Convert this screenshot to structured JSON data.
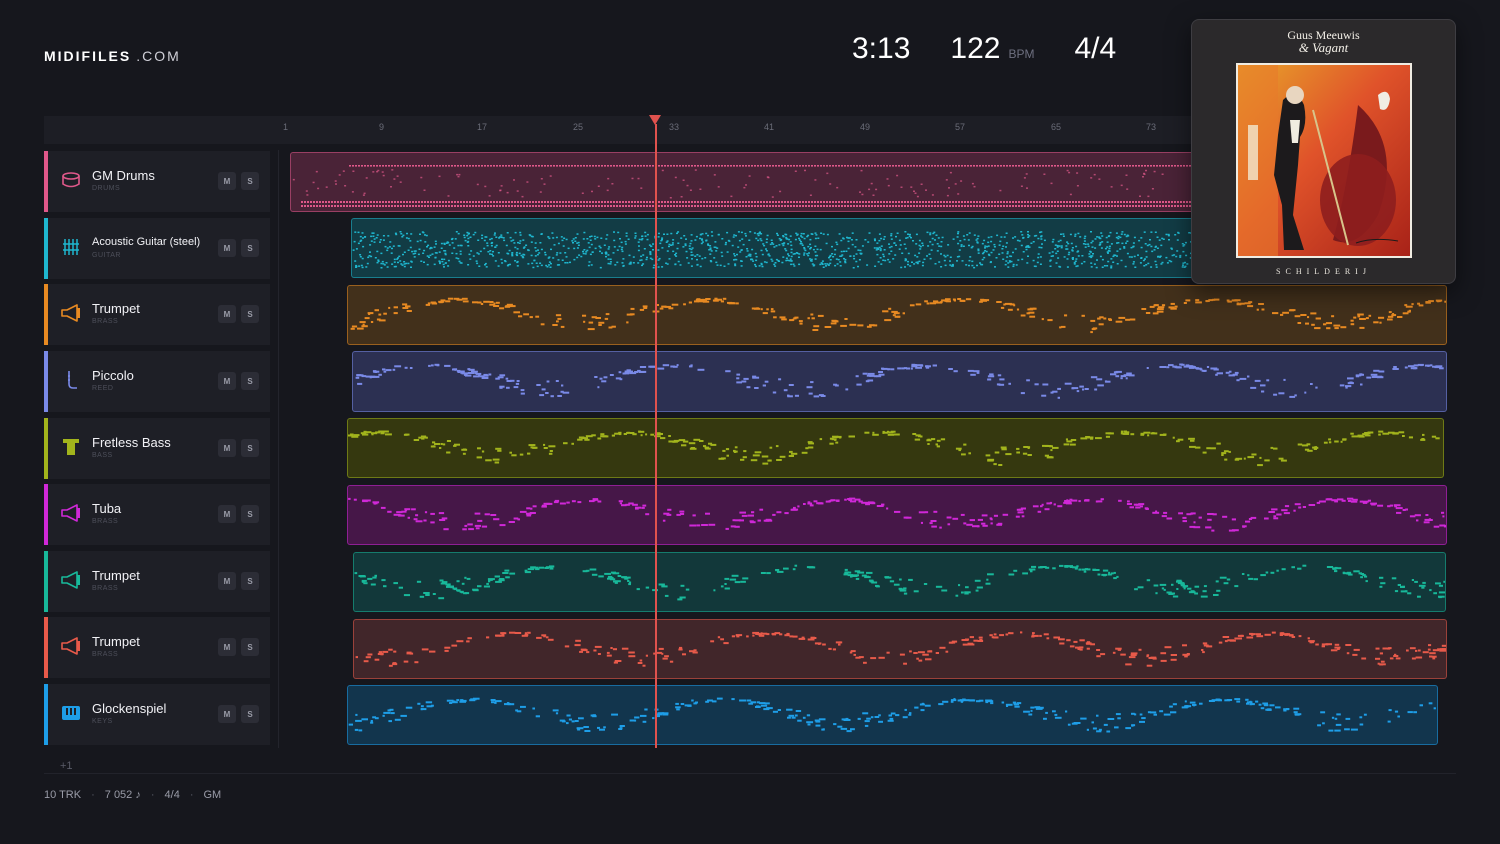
{
  "brand": {
    "name": "MIDIFILES",
    "suffix": ".COM"
  },
  "transport": {
    "time": "3:13",
    "tempo": "122",
    "tempo_unit": "BPM",
    "meter": "4/4"
  },
  "ruler": {
    "ticks": [
      "1",
      "9",
      "17",
      "25",
      "33",
      "41",
      "49",
      "57",
      "65",
      "73"
    ]
  },
  "tracks": [
    {
      "name": "GM Drums",
      "category": "DRUMS",
      "icon": "drum-icon",
      "color": "#e0588a",
      "bg": "#4a2337",
      "mute": "M",
      "solo": "S"
    },
    {
      "name": "Acoustic Guitar (steel)",
      "category": "GUITAR",
      "icon": "guitar-icon",
      "color": "#1fb7cf",
      "bg": "#123c45",
      "mute": "M",
      "solo": "S"
    },
    {
      "name": "Trumpet",
      "category": "BRASS",
      "icon": "horn-icon",
      "color": "#e88a22",
      "bg": "#42301b",
      "mute": "M",
      "solo": "S"
    },
    {
      "name": "Piccolo",
      "category": "REED",
      "icon": "reed-icon",
      "color": "#7a8ae8",
      "bg": "#2c3052",
      "mute": "M",
      "solo": "S"
    },
    {
      "name": "Fretless Bass",
      "category": "BASS",
      "icon": "bass-icon",
      "color": "#a2b41c",
      "bg": "#35380f",
      "mute": "M",
      "solo": "S"
    },
    {
      "name": "Tuba",
      "category": "BRASS",
      "icon": "horn-icon",
      "color": "#d028d8",
      "bg": "#461748",
      "mute": "M",
      "solo": "S"
    },
    {
      "name": "Trumpet",
      "category": "BRASS",
      "icon": "horn-icon",
      "color": "#18b89a",
      "bg": "#12383a",
      "mute": "M",
      "solo": "S"
    },
    {
      "name": "Trumpet",
      "category": "BRASS",
      "icon": "horn-icon",
      "color": "#e85a4a",
      "bg": "#41262a",
      "mute": "M",
      "solo": "S"
    },
    {
      "name": "Glockenspiel",
      "category": "KEYS",
      "icon": "keys-icon",
      "color": "#1e9ee8",
      "bg": "#12354d",
      "mute": "M",
      "solo": "S"
    }
  ],
  "more_tracks": "+1",
  "footer": {
    "tracks": "10 TRK",
    "notes": "7 052 ♪",
    "meter": "4/4",
    "standard": "GM",
    "sep": "·"
  },
  "album": {
    "artist": "Guus Meeuwis",
    "amp": "&",
    "band": "Vagant",
    "title": "SCHILDERIJ"
  }
}
